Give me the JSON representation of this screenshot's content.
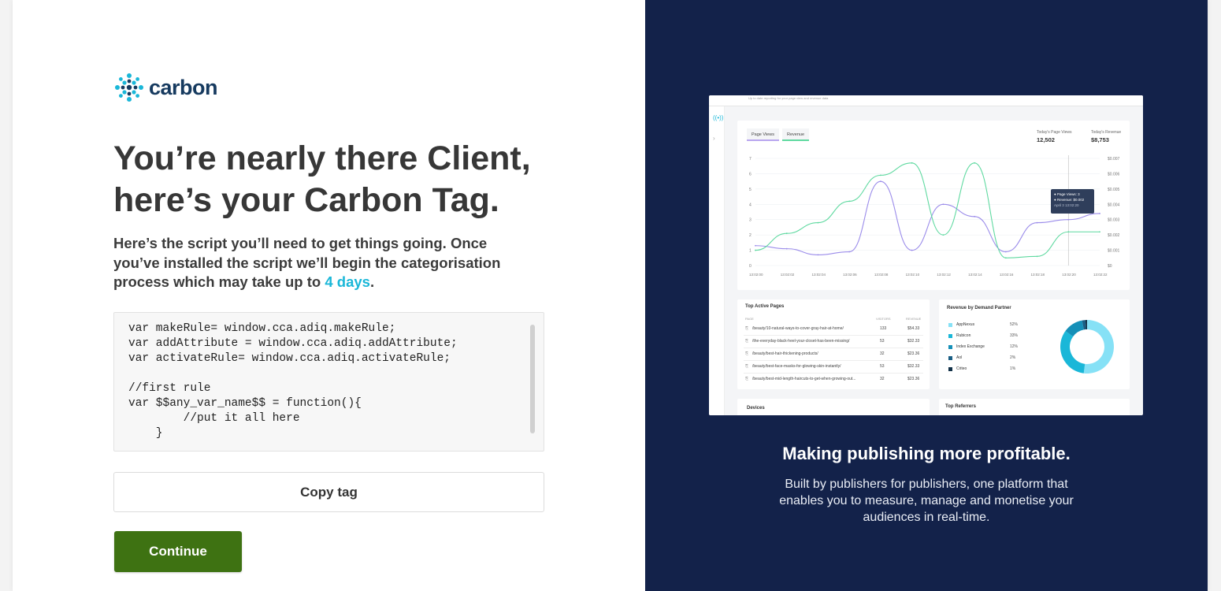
{
  "brand": {
    "name": "carbon",
    "accent": "#1ab7d8",
    "dark": "#163a5f"
  },
  "headline": {
    "line1": "You’re nearly there Client,",
    "line2": "here’s your Carbon Tag."
  },
  "intro": {
    "text": "Here’s the script you’ll need to get things going. Once you’ve installed the script we’ll begin the categorisation process which may take up to ",
    "highlight": "4 days",
    "end": "."
  },
  "code": "var makeRule= window.cca.adiq.makeRule;\nvar addAttribute = window.cca.adiq.addAttribute;\nvar activateRule= window.cca.adiq.activateRule;\n\n//first rule\nvar $$any_var_name$$ = function(){\n        //put it all here\n    }",
  "buttons": {
    "copy": "Copy tag",
    "continue": "Continue",
    "continue_color": "#3e7212"
  },
  "promo": {
    "title": "Making publishing more profitable.",
    "body": "Built by publishers for publishers, one platform that enables you to measure, manage and monetise your audiences in real-time.",
    "background": "#13224a"
  },
  "dashboard": {
    "banner": "Up to date reporting for your page view and revenue data",
    "tabs": [
      "Page Views",
      "Revenue"
    ],
    "stats": [
      {
        "label": "Today's Page Views",
        "value": "12,502"
      },
      {
        "label": "Today's Revenue",
        "value": "$8,753"
      }
    ],
    "tooltip": {
      "line1": "● Page Views: 3",
      "line2": "● Revenue: $0.002",
      "line3": "April 3 13:02:20"
    },
    "top_pages": {
      "title": "Top Active Pages",
      "headers": [
        "PAGE",
        "VISITORS",
        "REVENUE"
      ],
      "rows": [
        {
          "page": "/beauty/10-natural-ways-to-cover-gray-hair-at-home/",
          "visitors": "133",
          "revenue": "$54.33"
        },
        {
          "page": "/the-everyday-black-heel-your-closet-has-been-missing/",
          "visitors": "53",
          "revenue": "$32.33"
        },
        {
          "page": "/beauty/best-hair-thickening-products/",
          "visitors": "32",
          "revenue": "$23.36"
        },
        {
          "page": "/beauty/best-face-masks-for-glowing-skin-instantly/",
          "visitors": "53",
          "revenue": "$32.33"
        },
        {
          "page": "/beauty/best-mid-length-haircuts-to-get-when-growing-out...",
          "visitors": "32",
          "revenue": "$23.36"
        }
      ]
    },
    "partners": {
      "title": "Revenue by Demand Partner",
      "items": [
        {
          "name": "AppNexus",
          "pct": "52%",
          "color": "#86e1f6"
        },
        {
          "name": "Rubicon",
          "pct": "33%",
          "color": "#1ab7d8"
        },
        {
          "name": "Index Exchange",
          "pct": "12%",
          "color": "#1590b8"
        },
        {
          "name": "Aol",
          "pct": "2%",
          "color": "#1a5f85"
        },
        {
          "name": "Criteo",
          "pct": "1%",
          "color": "#123148"
        }
      ]
    },
    "bottom_cards": [
      "Devices",
      "Top Referrers"
    ]
  },
  "chart_data": {
    "type": "line",
    "x": [
      "13:02:00",
      "13:02:02",
      "13:02:04",
      "13:02:06",
      "13:02:08",
      "13:02:10",
      "13:02:12",
      "13:02:14",
      "13:02:16",
      "13:02:18",
      "13:02:20",
      "13:02:22"
    ],
    "series": [
      {
        "name": "Page Views",
        "color": "#9b8cea",
        "values": [
          1.3,
          1.1,
          0.7,
          0.9,
          5.5,
          1.0,
          4.0,
          3.2,
          0.9,
          2.8,
          3.0,
          3.4
        ]
      },
      {
        "name": "Revenue",
        "color": "#5fd9a0",
        "values": [
          1.0,
          2.1,
          2.8,
          4.2,
          5.9,
          6.7,
          2.0,
          6.7,
          0.5,
          0.6,
          2.2,
          2.2
        ]
      }
    ],
    "ylim_left": [
      0,
      7
    ],
    "y_ticks_left": [
      "0",
      "1",
      "2",
      "3",
      "4",
      "5",
      "6",
      "7"
    ],
    "y_ticks_right": [
      "$0",
      "$0.001",
      "$0.002",
      "$0.003",
      "$0.004",
      "$0.005",
      "$0.006",
      "$0.007"
    ],
    "highlight_x": "13:02:20"
  }
}
